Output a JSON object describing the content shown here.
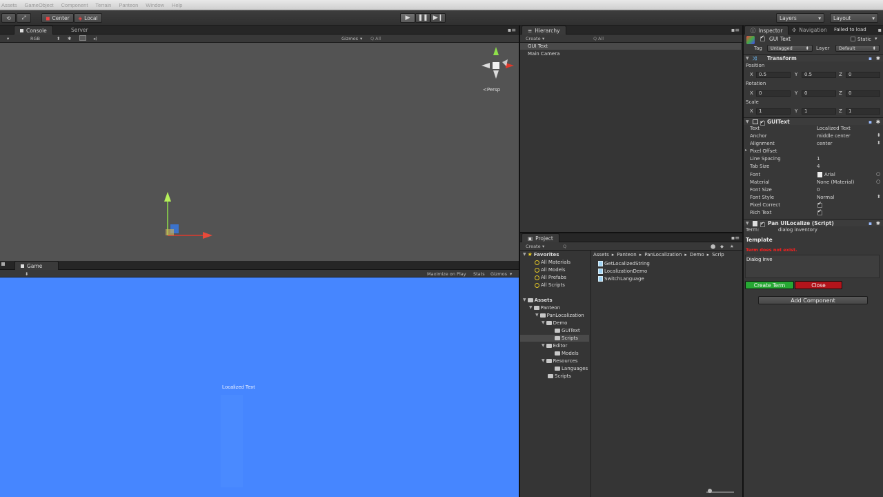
{
  "menu": [
    "Assets",
    "GameObject",
    "Component",
    "Terrain",
    "Panteon",
    "Window",
    "Help"
  ],
  "toolbar": {
    "pivot": "Center",
    "space": "Local",
    "layers": "Layers",
    "layout": "Layout"
  },
  "scene": {
    "tabs": [
      "Console",
      "Server"
    ],
    "render_mode": "RGB",
    "gizmos": "Gizmos",
    "search": "All",
    "persp": "<Persp"
  },
  "game": {
    "tab": "Game",
    "maximize": "Maximize on Play",
    "stats": "Stats",
    "gizmos": "Gizmos",
    "label": "Localized Text"
  },
  "hierarchy": {
    "tab": "Hierarchy",
    "create": "Create",
    "search": "All",
    "items": [
      "GUI Text",
      "Main Camera"
    ],
    "selected": 0
  },
  "project": {
    "tab": "Project",
    "create": "Create",
    "favorites_label": "Favorites",
    "favorites": [
      "All Materials",
      "All Models",
      "All Prefabs",
      "All Scripts"
    ],
    "assets_label": "Assets",
    "tree": [
      {
        "label": "Panteon",
        "level": 1
      },
      {
        "label": "PanLocalization",
        "level": 2
      },
      {
        "label": "Demo",
        "level": 3
      },
      {
        "label": "GUIText",
        "level": 4
      },
      {
        "label": "Scripts",
        "level": 4,
        "selected": true
      },
      {
        "label": "Editor",
        "level": 3
      },
      {
        "label": "Models",
        "level": 4
      },
      {
        "label": "Resources",
        "level": 3
      },
      {
        "label": "Languages",
        "level": 4
      },
      {
        "label": "Scripts",
        "level": 2
      }
    ],
    "breadcrumb": [
      "Assets",
      "Panteon",
      "PanLocalization",
      "Demo",
      "Scrip"
    ],
    "files": [
      "GetLocalizedString",
      "LocalizationDemo",
      "SwitchLanguage"
    ]
  },
  "inspector": {
    "tabs": [
      "Inspector",
      "Navigation"
    ],
    "failed": "Failed to load",
    "object_name": "GUI Text",
    "static_label": "Static",
    "tag_label": "Tag",
    "tag_value": "Untagged",
    "layer_label": "Layer",
    "layer_value": "Default",
    "transform": {
      "title": "Transform",
      "position_label": "Position",
      "rotation_label": "Rotation",
      "scale_label": "Scale",
      "position": [
        "0.5",
        "0.5",
        "0"
      ],
      "rotation": [
        "0",
        "0",
        "0"
      ],
      "scale": [
        "1",
        "1",
        "1"
      ],
      "axes": [
        "X",
        "Y",
        "Z"
      ]
    },
    "guitext": {
      "title": "GUIText",
      "props": [
        {
          "label": "Text",
          "value": "Localized Text"
        },
        {
          "label": "Anchor",
          "value": "middle center"
        },
        {
          "label": "Alignment",
          "value": "center"
        },
        {
          "label": "Pixel Offset",
          "value": ""
        },
        {
          "label": "Line Spacing",
          "value": "1"
        },
        {
          "label": "Tab Size",
          "value": "4"
        },
        {
          "label": "Font",
          "value": "Arial"
        },
        {
          "label": "Material",
          "value": "None (Material)"
        },
        {
          "label": "Font Size",
          "value": "0"
        },
        {
          "label": "Font Style",
          "value": "Normal"
        },
        {
          "label": "Pixel Correct",
          "value": ""
        },
        {
          "label": "Rich Text",
          "value": ""
        }
      ]
    },
    "localize": {
      "title": "Pan UILocalize (Script)",
      "term_label": "Term:",
      "term_value": "dialog inventory",
      "template_label": "Template",
      "warning": "Term does not exist.",
      "input_value": "Dialog Inve",
      "create_term": "Create Term",
      "close": "Close",
      "add_component": "Add Component"
    }
  },
  "colors": {
    "game_bg": "#4686ff",
    "create_term": "#26a833",
    "close": "#b3141b",
    "warning": "#ff1e1e"
  }
}
